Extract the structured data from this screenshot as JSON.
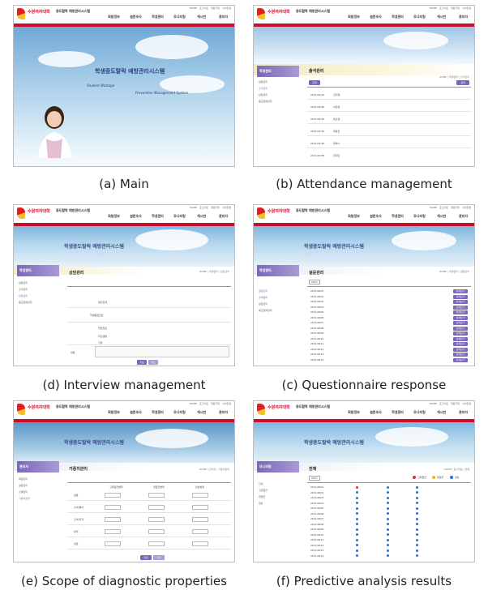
{
  "app": {
    "logo_text": "수원여자대학",
    "system_name": "중도탈락 예방관리시스템",
    "util_links": "HOME 로그아웃 회원가입 사이트맵",
    "nav": [
      "회원정보",
      "설문조사",
      "학생관리",
      "모니터링",
      "게시판",
      "관리자"
    ],
    "banner_title": "학생중도탈락 예방관리시스템"
  },
  "main": {
    "title": "학생중도탈락 예방관리시스템",
    "sub1": "Student Wastage",
    "sub2": "Prevention Management System"
  },
  "attendance": {
    "sidebar_head": "학생관리",
    "title": "출석관리",
    "breadcrumb": "HOME | 학생관리 | 출석관리",
    "side_items": [
      "설문관리",
      "출석관리",
      "상담관리",
      "중도탈락관리"
    ],
    "filter_label": "조회",
    "search_button": "검색",
    "rows": [
      {
        "date": "2011/01/24",
        "name": "김지영"
      },
      {
        "date": "2011/01/30",
        "name": "이민정"
      },
      {
        "date": "2011/01/30",
        "name": "박소연"
      },
      {
        "date": "2011/01/30",
        "name": "최유진"
      },
      {
        "date": "2011/01/30",
        "name": "정하나"
      },
      {
        "date": "2011/01/30",
        "name": "한지민"
      }
    ]
  },
  "interview": {
    "sidebar_head": "학생관리",
    "title": "상담관리",
    "breadcrumb": "HOME | 학생관리 | 상담관리",
    "side_items": [
      "설문관리",
      "출석관리",
      "상담관리",
      "중도탈락관리"
    ],
    "labels": [
      "대인관계",
      "학생종합진단",
      "학업진로",
      "학교생활",
      "기타"
    ],
    "memo_label": "내용",
    "save_button": "저장",
    "cancel_button": "취소"
  },
  "questionnaire": {
    "sidebar_head": "학생관리",
    "title": "설문관리",
    "breadcrumb": "HOME | 학생관리 | 설문관리",
    "year": "2011",
    "side_items": [
      "설문관리",
      "출석관리",
      "상담관리",
      "중도탈락관리"
    ],
    "rows": [
      "2011/0001",
      "2011/0002",
      "2011/0003",
      "2011/0004",
      "2011/0005",
      "2011/0006",
      "2011/0007",
      "2011/0008",
      "2011/0009",
      "2011/0010",
      "2011/0011",
      "2011/0012",
      "2011/0013",
      "2011/0014"
    ],
    "button_label": "상세보기"
  },
  "scope": {
    "sidebar_head": "관리자",
    "title": "가중치관리",
    "breadcrumb": "HOME | 관리자 | 가중치관리",
    "side_items": [
      "회원관리",
      "설문관리",
      "출결관리",
      "가중치관리"
    ],
    "col_heads": [
      "고위험군범위",
      "위험군범위",
      "정상범위"
    ],
    "rows": [
      "설문",
      "출석/결석",
      "출석/지각",
      "성적",
      "상담"
    ],
    "save_button": "저장",
    "cancel_button": "취소"
  },
  "predictive": {
    "sidebar_head": "모니터링",
    "title": "전체",
    "breadcrumb": "HOME | 모니터링 | 전체",
    "year": "2011",
    "legend": [
      "고위험군",
      "위험군",
      "정상"
    ],
    "side_items": [
      "전체",
      "고위험군",
      "위험군",
      "정상"
    ],
    "rows": [
      "2011/0001",
      "2011/0002",
      "2011/0003",
      "2011/0004",
      "2011/0005",
      "2011/0006",
      "2011/0007",
      "2011/0008",
      "2011/0009",
      "2011/0010",
      "2011/0011",
      "2011/0012",
      "2011/0013",
      "2011/0014"
    ]
  },
  "captions": {
    "a": "(a)  Main",
    "b": "(b)  Attendance management",
    "d": "(d)  Interview management",
    "c": "(c)  Questionnaire response",
    "e": "(e)  Scope of diagnostic properties",
    "f": "(f)  Predictive analysis results"
  },
  "colors": {
    "brand_red": "#c8102e",
    "accent_purple": "#7a67b8",
    "risk_high": "#d9322a",
    "risk_mid": "#f0b323",
    "risk_normal": "#2b6fd6"
  }
}
